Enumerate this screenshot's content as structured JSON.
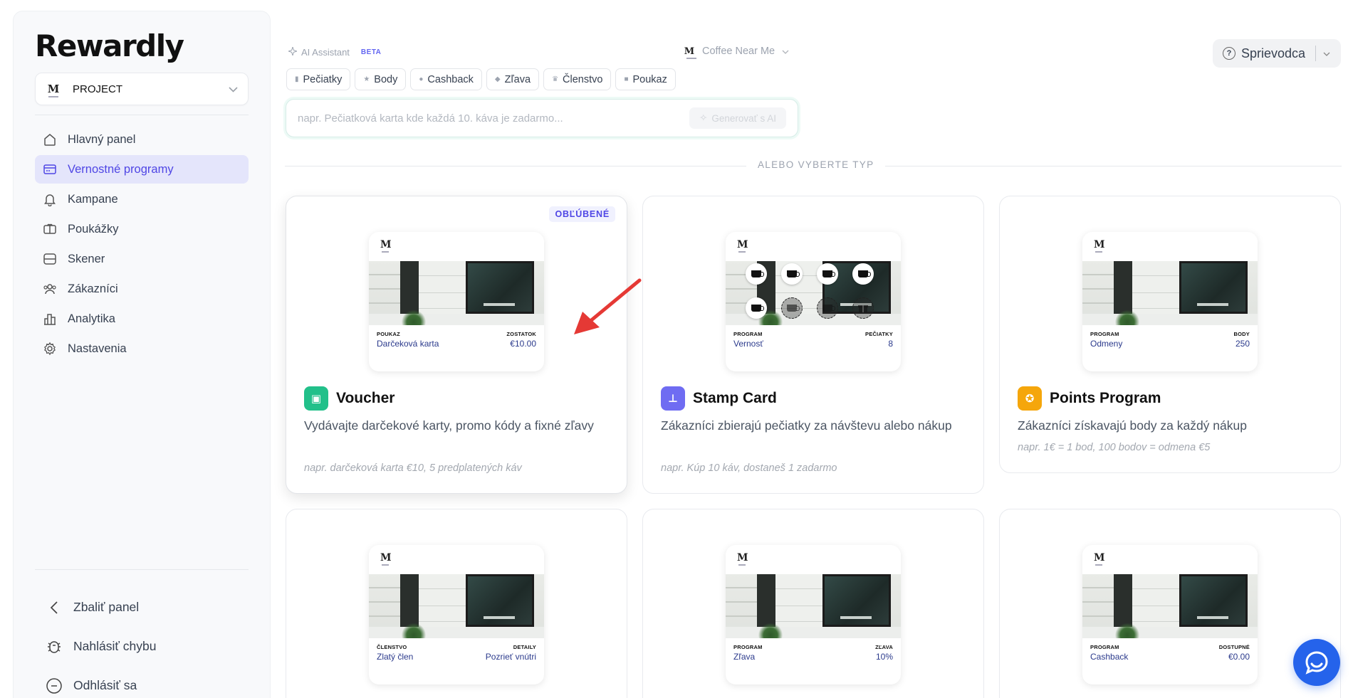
{
  "brand": {
    "logo_text": "Rewardly"
  },
  "project": {
    "name": "PROJECT",
    "logo_letter": "M"
  },
  "nav": [
    {
      "label": "Hlavný panel",
      "icon": "home-icon"
    },
    {
      "label": "Vernostné programy",
      "icon": "card-icon",
      "active": true
    },
    {
      "label": "Kampane",
      "icon": "bell-icon"
    },
    {
      "label": "Poukážky",
      "icon": "voucher-icon"
    },
    {
      "label": "Skener",
      "icon": "scan-icon"
    },
    {
      "label": "Zákazníci",
      "icon": "users-icon"
    },
    {
      "label": "Analytika",
      "icon": "chart-icon"
    },
    {
      "label": "Nastavenia",
      "icon": "settings-icon"
    }
  ],
  "bottom_nav": [
    {
      "label": "Zbaliť panel",
      "icon": "chevron-left-icon"
    },
    {
      "label": "Nahlásiť chybu",
      "icon": "bug-icon"
    },
    {
      "label": "Odhlásiť sa",
      "icon": "logout-icon"
    }
  ],
  "top": {
    "ai_label": "AI Assistant",
    "beta": "BETA",
    "location": "Coffee Near Me",
    "guide": "Sprievodca"
  },
  "chips": [
    {
      "label": "Pečiatky"
    },
    {
      "label": "Body"
    },
    {
      "label": "Cashback"
    },
    {
      "label": "Zľava"
    },
    {
      "label": "Členstvo"
    },
    {
      "label": "Poukaz"
    }
  ],
  "prompt": {
    "placeholder": "napr. Pečiatková karta kde každá 10. káva je zadarmo...",
    "generate": "Generovať s AI"
  },
  "or_text": "ALEBO VYBERTE TYP",
  "cards": [
    {
      "badge": "OBĽÚBENÉ",
      "title": "Voucher",
      "icon_color": "#22c08a",
      "desc": "Vydávajte darčekové karty, promo kódy a fixné zľavy",
      "example": "napr. darčeková karta €10, 5 predplatených káv",
      "preview": {
        "left_label": "POUKAZ",
        "left_value": "Darčeková karta",
        "right_label": "ZOSTATOK",
        "right_value": "€10.00"
      }
    },
    {
      "title": "Stamp Card",
      "icon_color": "#6f6cf2",
      "desc": "Zákazníci zbierajú pečiatky za návštevu alebo nákup",
      "example": "napr. Kúp 10 káv, dostaneš 1 zadarmo",
      "preview": {
        "left_label": "PROGRAM",
        "left_value": "Vernosť",
        "right_label": "PEČIATKY",
        "right_value": "8"
      }
    },
    {
      "title": "Points Program",
      "icon_color": "#f5a60b",
      "desc": "Zákazníci získavajú body za každý nákup",
      "example": "napr. 1€ = 1 bod, 100 bodov = odmena €5",
      "preview": {
        "left_label": "PROGRAM",
        "left_value": "Odmeny",
        "right_label": "BODY",
        "right_value": "250"
      }
    },
    {
      "preview": {
        "left_label": "ČLENSTVO",
        "left_value": "Zlatý člen",
        "right_label": "DETAILY",
        "right_value": "Pozrieť vnútri"
      }
    },
    {
      "preview": {
        "left_label": "PROGRAM",
        "left_value": "Zľava",
        "right_label": "ZĽAVA",
        "right_value": "10%"
      }
    },
    {
      "preview": {
        "left_label": "PROGRAM",
        "left_value": "Cashback",
        "right_label": "DOSTUPNÉ",
        "right_value": "€0.00"
      }
    }
  ],
  "colors": {
    "accent": "#4f46e5",
    "active_bg": "#e4e5fb",
    "arrow": "#e53935",
    "chat": "#2563eb"
  }
}
